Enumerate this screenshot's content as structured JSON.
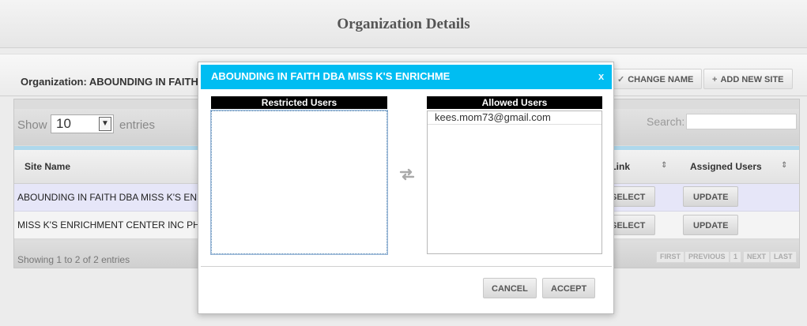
{
  "page": {
    "title": "Organization Details"
  },
  "organization": {
    "label": "Organization: ABOUNDING IN FAITH DBA MISS K'S ENRICHMENT CENTER INC",
    "change_name_label": "CHANGE NAME",
    "add_new_site_label": "ADD NEW SITE"
  },
  "table_controls": {
    "show_label": "Show",
    "entries_value": "10",
    "entries_label": "entries",
    "search_label": "Search:",
    "search_value": ""
  },
  "table": {
    "columns": [
      "Site Name",
      "Site Link",
      "Assigned Users"
    ],
    "rows": [
      {
        "site_name": "ABOUNDING IN FAITH DBA MISS K'S ENRICHMENT CENTER",
        "site_link_button": "SELECT",
        "assigned_button": "UPDATE"
      },
      {
        "site_name": "MISS K'S ENRICHMENT CENTER INC PHASE II",
        "site_link_button": "SELECT",
        "assigned_button": "UPDATE"
      }
    ],
    "footer_info": "Showing 1 to 2 of 2 entries",
    "pager": [
      "FIRST",
      "PREVIOUS",
      "1",
      "NEXT",
      "LAST"
    ]
  },
  "modal": {
    "title": "ABOUNDING IN FAITH DBA MISS K'S ENRICHME",
    "close_label": "x",
    "restricted_header": "Restricted Users",
    "allowed_header": "Allowed Users",
    "restricted_users": [],
    "allowed_users": [
      "kees.mom73@gmail.com"
    ],
    "cancel_label": "CANCEL",
    "accept_label": "ACCEPT"
  },
  "colors": {
    "modal_header": "#00bdf2",
    "list_header": "#000000",
    "selected_row": "#e6e6f8"
  }
}
